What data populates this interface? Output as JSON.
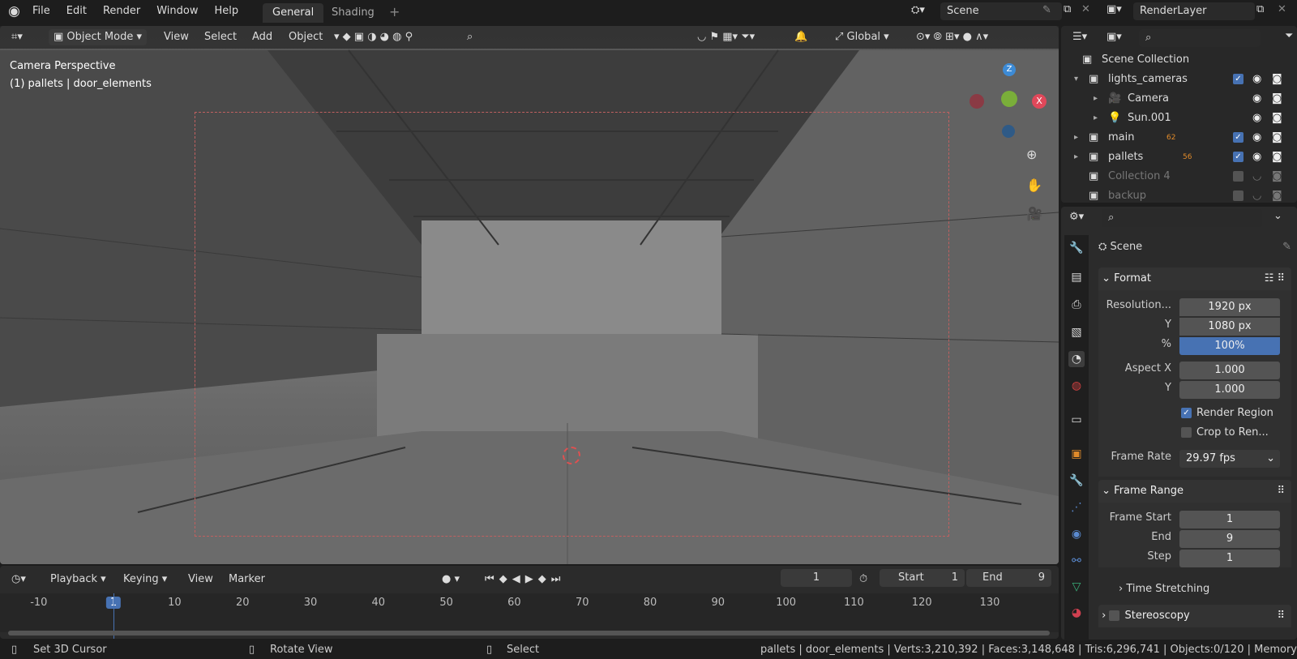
{
  "menu": [
    "File",
    "Edit",
    "Render",
    "Window",
    "Help"
  ],
  "workspaces": [
    "General",
    "Shading"
  ],
  "scene": "Scene",
  "view_layer": "RenderLayer",
  "viewport_header": {
    "mode": "Object Mode",
    "menus": [
      "View",
      "Select",
      "Add",
      "Object"
    ],
    "transform": "Global"
  },
  "viewport": {
    "title": "Camera Perspective",
    "subtitle": "(1) pallets | door_elements",
    "gizmo": {
      "z": "Z",
      "x": "X"
    }
  },
  "timeline": {
    "menus": [
      "Playback",
      "Keying",
      "View",
      "Marker"
    ],
    "current_frame": "1",
    "start_label": "Start",
    "start": "1",
    "end_label": "End",
    "end": "9",
    "ticks": [
      "-10",
      "1",
      "10",
      "20",
      "30",
      "40",
      "50",
      "60",
      "70",
      "80",
      "90",
      "100",
      "110",
      "120",
      "130"
    ]
  },
  "status": {
    "left": "Set 3D Cursor",
    "middle": "Rotate View",
    "right": "Select",
    "stats": "pallets | door_elements | Verts:3,210,392 | Faces:3,148,648 | Tris:6,296,741 | Objects:0/120 | Memory"
  },
  "outliner": {
    "items": [
      {
        "name": "Scene Collection"
      },
      {
        "name": "lights_cameras"
      },
      {
        "name": "Camera"
      },
      {
        "name": "Sun.001"
      },
      {
        "name": "main",
        "badge": "62"
      },
      {
        "name": "pallets",
        "badge": "56"
      },
      {
        "name": "Collection 4"
      },
      {
        "name": "backup"
      }
    ]
  },
  "properties": {
    "context": "Scene",
    "format": {
      "title": "Format",
      "res_label": "Resolution...",
      "res_x": "1920 px",
      "y_label": "Y",
      "res_y": "1080 px",
      "pct_label": "%",
      "pct": "100%",
      "aspect_label": "Aspect X",
      "aspect_x": "1.000",
      "aspect_y_label": "Y",
      "aspect_y": "1.000",
      "render_region": "Render Region",
      "crop": "Crop to Ren...",
      "fps_label": "Frame Rate",
      "fps": "29.97 fps"
    },
    "frame_range": {
      "title": "Frame Range",
      "start_label": "Frame Start",
      "start": "1",
      "end_label": "End",
      "end": "9",
      "step_label": "Step",
      "step": "1"
    },
    "time_stretching": "Time Stretching",
    "stereoscopy": "Stereoscopy"
  },
  "colors": {
    "accent": "#4772b3",
    "x_axis": "#e0485a",
    "y_axis": "#7aae3a",
    "z_axis": "#3d8bd6"
  }
}
